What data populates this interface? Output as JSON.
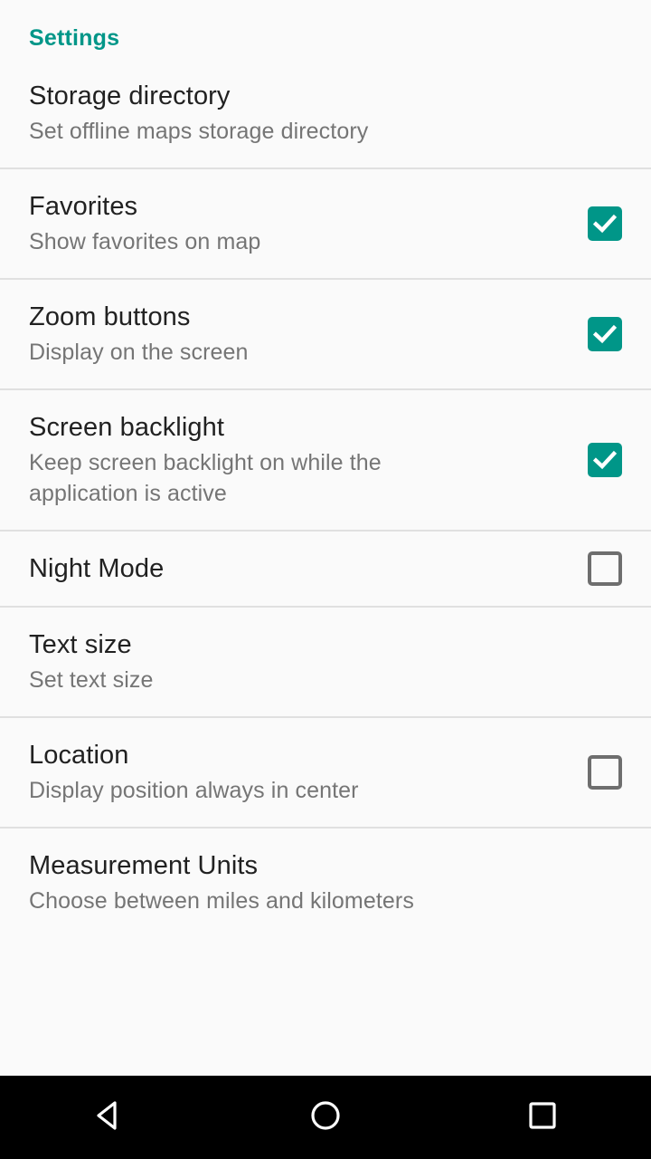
{
  "screen": {
    "background_color": "#fafafa",
    "accent_color": "#009688",
    "title_color": "#212121",
    "summary_color": "#757575",
    "divider_color": "#e0e0e0"
  },
  "settings": {
    "category_label": "Settings",
    "preferences": [
      {
        "key": "storage-directory",
        "title": "Storage directory",
        "summary": "Set offline maps storage directory",
        "widget": "none",
        "checked": null,
        "divider_above": false
      },
      {
        "key": "favorites",
        "title": "Favorites",
        "summary": "Show favorites on map",
        "widget": "checkbox",
        "checked": true,
        "divider_above": true
      },
      {
        "key": "zoom-buttons",
        "title": "Zoom buttons",
        "summary": "Display on the screen",
        "widget": "checkbox",
        "checked": true,
        "divider_above": true
      },
      {
        "key": "screen-backlight",
        "title": "Screen backlight",
        "summary": "Keep screen backlight on while the application is active",
        "widget": "checkbox",
        "checked": true,
        "divider_above": true
      },
      {
        "key": "night-mode",
        "title": "Night Mode",
        "summary": "",
        "widget": "checkbox",
        "checked": false,
        "divider_above": true
      },
      {
        "key": "text-size",
        "title": "Text size",
        "summary": "Set text size",
        "widget": "none",
        "checked": null,
        "divider_above": true
      },
      {
        "key": "location",
        "title": "Location",
        "summary": "Display position always in center",
        "widget": "checkbox",
        "checked": false,
        "divider_above": true
      },
      {
        "key": "measurement-units",
        "title": "Measurement Units",
        "summary": "Choose between miles and kilometers",
        "widget": "none",
        "checked": null,
        "divider_above": true
      }
    ]
  },
  "navigation_bar": {
    "background_color": "#000000",
    "buttons": [
      {
        "key": "back",
        "icon": "back-triangle-icon"
      },
      {
        "key": "home",
        "icon": "home-circle-icon"
      },
      {
        "key": "recents",
        "icon": "recents-square-icon"
      }
    ]
  }
}
